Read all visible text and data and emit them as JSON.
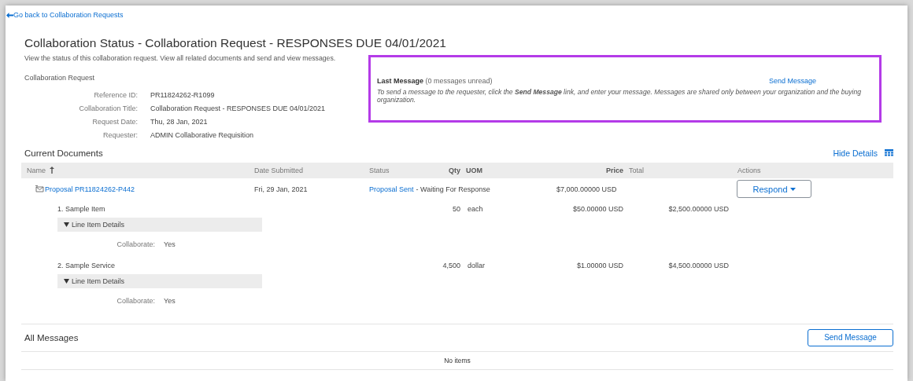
{
  "back_link": "Go back to Collaboration Requests",
  "title": "Collaboration Status - Collaboration Request - RESPONSES DUE 04/01/2021",
  "description": "View the status of this collaboration request. View all related documents and send and view messages.",
  "request": {
    "heading": "Collaboration Request",
    "fields": [
      {
        "label": "Reference ID:",
        "value": "PR11824262-R1099"
      },
      {
        "label": "Collaboration Title:",
        "value": "Collaboration Request - RESPONSES DUE 04/01/2021"
      },
      {
        "label": "Request Date:",
        "value": "Thu, 28 Jan, 2021"
      },
      {
        "label": "Requester:",
        "value": "ADMIN Collaborative Requisition"
      }
    ]
  },
  "last_message": {
    "heading": "Last Message",
    "unread": "(0 messages unread)",
    "link": "Send Message",
    "text": "To send a message to the requester, click the **Send Message** link, and enter your message. Messages are shared only between your organization and the buying organization."
  },
  "documents": {
    "heading": "Current Documents",
    "hide_details": "Hide Details",
    "columns": [
      {
        "label": "Name",
        "emphasized": false,
        "sorted": true
      },
      {
        "label": "Date Submitted",
        "emphasized": false,
        "sorted": false
      },
      {
        "label": "Status",
        "emphasized": false,
        "sorted": false
      },
      {
        "label": "Qty",
        "emphasized": true,
        "sorted": false
      },
      {
        "label": "UOM",
        "emphasized": true,
        "sorted": false
      },
      {
        "label": "Price",
        "emphasized": true,
        "sorted": false
      },
      {
        "label": "Total",
        "emphasized": false,
        "sorted": false
      },
      {
        "label": "Actions",
        "emphasized": false,
        "sorted": false
      }
    ],
    "proposal": {
      "name": "Proposal PR11824262-P442",
      "date": "Fri, 29 Jan, 2021",
      "status_link": "Proposal Sent",
      "status_text": "- Waiting For Response",
      "total": "$7,000.00000 USD",
      "action": "Respond"
    },
    "items": [
      {
        "name": "1. Sample Item",
        "qty": "50",
        "uom": "each",
        "price": "$50.00000 USD",
        "total": "$2,500.00000 USD",
        "details_label": "Line Item Details",
        "expanded": true,
        "fields": [
          {
            "label": "Collaborate:",
            "value": "Yes"
          }
        ]
      },
      {
        "name": "2. Sample Service",
        "qty": "4,500",
        "uom": "dollar",
        "price": "$1.00000 USD",
        "total": "$4,500.00000 USD",
        "details_label": "Line Item Details",
        "expanded": true,
        "fields": [
          {
            "label": "Collaborate:",
            "value": "Yes"
          }
        ]
      }
    ]
  },
  "messages": {
    "heading": "All Messages",
    "button": "Send Message",
    "empty": "No items"
  }
}
